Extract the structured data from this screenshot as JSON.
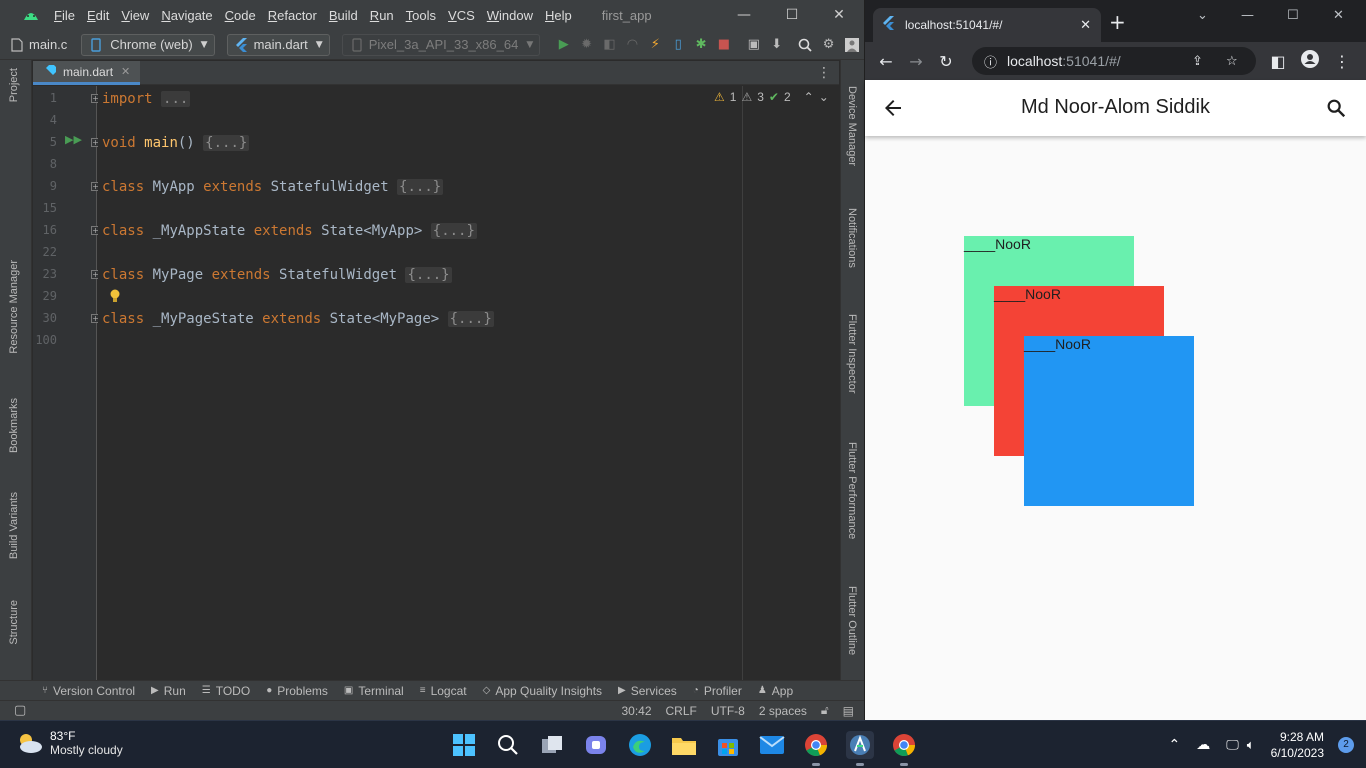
{
  "ide": {
    "menu": [
      "File",
      "Edit",
      "View",
      "Navigate",
      "Code",
      "Refactor",
      "Build",
      "Run",
      "Tools",
      "VCS",
      "Window",
      "Help"
    ],
    "project_name": "first_app",
    "toolbar": {
      "breadcrumb": "main.c",
      "device_selector": "Chrome (web)",
      "run_config": "main.dart",
      "emulator": "Pixel_3a_API_33_x86_64"
    },
    "left_tool_tabs": [
      "Project",
      "Resource Manager",
      "Bookmarks",
      "Build Variants",
      "Structure"
    ],
    "right_tool_tabs": [
      "Device Manager",
      "Notifications",
      "Flutter Inspector",
      "Flutter Performance",
      "Flutter Outline"
    ],
    "editor_tab": "main.dart",
    "inspections": {
      "warnings": "1",
      "weak_warnings": "3",
      "typos": "2"
    },
    "lines": [
      {
        "num": "1",
        "tokens": [
          {
            "t": "import",
            "c": "kw"
          },
          {
            "t": " ",
            "c": ""
          },
          {
            "t": "...",
            "c": "folded"
          }
        ]
      },
      {
        "num": "4",
        "tokens": []
      },
      {
        "num": "5",
        "tokens": [
          {
            "t": "void",
            "c": "kw"
          },
          {
            "t": " ",
            "c": ""
          },
          {
            "t": "main",
            "c": "fn"
          },
          {
            "t": "() ",
            "c": ""
          },
          {
            "t": "{...}",
            "c": "folded"
          }
        ]
      },
      {
        "num": "8",
        "tokens": []
      },
      {
        "num": "9",
        "tokens": [
          {
            "t": "class",
            "c": "kw"
          },
          {
            "t": " MyApp ",
            "c": ""
          },
          {
            "t": "extends",
            "c": "kw"
          },
          {
            "t": " StatefulWidget ",
            "c": ""
          },
          {
            "t": "{...}",
            "c": "folded"
          }
        ]
      },
      {
        "num": "15",
        "tokens": []
      },
      {
        "num": "16",
        "tokens": [
          {
            "t": "class",
            "c": "kw"
          },
          {
            "t": " _MyAppState ",
            "c": ""
          },
          {
            "t": "extends",
            "c": "kw"
          },
          {
            "t": " State<MyApp> ",
            "c": ""
          },
          {
            "t": "{...}",
            "c": "folded"
          }
        ]
      },
      {
        "num": "22",
        "tokens": []
      },
      {
        "num": "23",
        "tokens": [
          {
            "t": "class",
            "c": "kw"
          },
          {
            "t": " MyPage ",
            "c": ""
          },
          {
            "t": "extends",
            "c": "kw"
          },
          {
            "t": " StatefulWidget ",
            "c": ""
          },
          {
            "t": "{...}",
            "c": "folded"
          }
        ]
      },
      {
        "num": "29",
        "tokens": []
      },
      {
        "num": "30",
        "tokens": [
          {
            "t": "class",
            "c": "kw"
          },
          {
            "t": " _MyPageState ",
            "c": ""
          },
          {
            "t": "extends",
            "c": "kw"
          },
          {
            "t": " State<MyPage> ",
            "c": ""
          },
          {
            "t": "{...}",
            "c": "folded"
          }
        ]
      },
      {
        "num": "100",
        "tokens": []
      }
    ],
    "bottom_tabs": [
      "Version Control",
      "Run",
      "TODO",
      "Problems",
      "Terminal",
      "Logcat",
      "App Quality Insights",
      "Services",
      "Profiler",
      "App"
    ],
    "status": {
      "position": "30:42",
      "line_sep": "CRLF",
      "encoding": "UTF-8",
      "indent": "2 spaces"
    }
  },
  "browser": {
    "tab_title": "localhost:51041/#/",
    "url_host": "localhost",
    "url_rest": ":51041/#/",
    "app": {
      "title": "Md Noor-Alom Siddik",
      "boxes": [
        {
          "label": "____NooR",
          "color": "#69f0ae"
        },
        {
          "label": "____NooR",
          "color": "#f44336"
        },
        {
          "label": "____NooR",
          "color": "#2196f3"
        }
      ]
    }
  },
  "taskbar": {
    "weather_temp": "83°F",
    "weather_desc": "Mostly cloudy",
    "time": "9:28 AM",
    "date": "6/10/2023",
    "notifications": "2"
  }
}
